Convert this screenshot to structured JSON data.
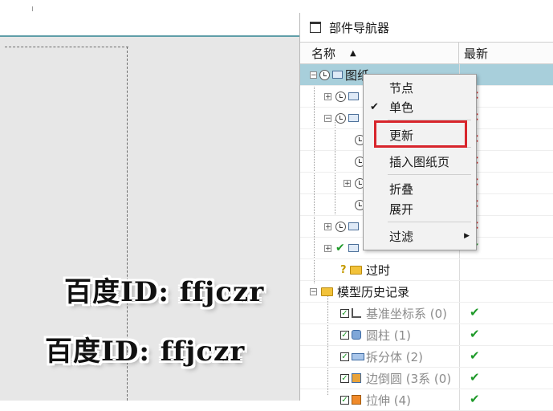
{
  "panel": {
    "title": "部件导航器",
    "columns": {
      "name": "名称",
      "latest": "最新"
    }
  },
  "tree": {
    "root_label": "图纸",
    "outdated_label": "过时",
    "model_history_label": "模型历史记录",
    "features": [
      {
        "label": "基准坐标系 (0)"
      },
      {
        "label": "圆柱 (1)"
      },
      {
        "label": "拆分体 (2)"
      },
      {
        "label": "边倒圆 (3系 (0)"
      },
      {
        "label": "拉伸 (4)"
      }
    ]
  },
  "context_menu": {
    "items": [
      "节点",
      "单色",
      "更新",
      "插入图纸页",
      "折叠",
      "展开",
      "过滤"
    ],
    "checked_item": "单色",
    "highlighted_item": "更新"
  },
  "watermark": "百度ID: ffjczr",
  "colors": {
    "selection": "#a8cfdb",
    "highlight_border": "#d8252c",
    "error_x": "#d42020",
    "ok_check": "#1f9a2a"
  }
}
